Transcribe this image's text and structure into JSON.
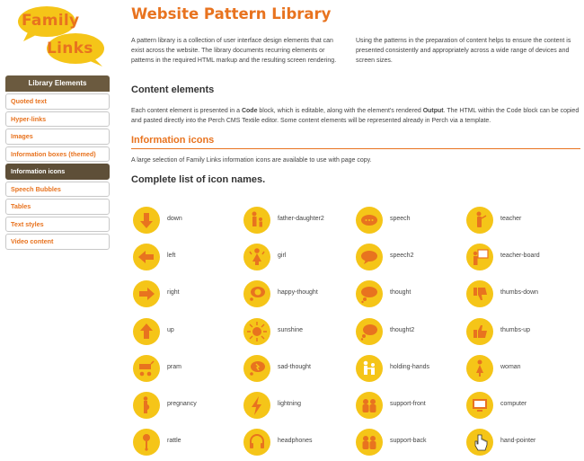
{
  "logo": {
    "word1": "Family",
    "word2": "Links"
  },
  "colors": {
    "accent": "#e8731f",
    "icon_bg": "#f5c518",
    "sidebar_header": "#6b5a3f"
  },
  "sidebar": {
    "header": "Library Elements",
    "items": [
      {
        "label": "Quoted text",
        "active": false
      },
      {
        "label": "Hyper-links",
        "active": false
      },
      {
        "label": "Images",
        "active": false
      },
      {
        "label": "Information boxes (themed)",
        "active": false
      },
      {
        "label": "Information icons",
        "active": true
      },
      {
        "label": "Speech Bubbles",
        "active": false
      },
      {
        "label": "Tables",
        "active": false
      },
      {
        "label": "Text styles",
        "active": false
      },
      {
        "label": "Video content",
        "active": false
      }
    ]
  },
  "main": {
    "title": "Website Pattern Library",
    "intro_left": "A pattern library is a collection of user interface design elements that can exist across the website. The library documents recurring elements or patterns in the required HTML markup and the resulting screen rendering.",
    "intro_right": "Using the patterns in the preparation of content helps to ensure the content is presented consistently and appropriately across a wide range of devices and screen sizes.",
    "content_heading": "Content elements",
    "content_desc_1": "Each content element is presented in a ",
    "content_desc_code": "Code",
    "content_desc_2": " block, which is editable, along with the element's rendered ",
    "content_desc_output": "Output",
    "content_desc_3": ". The HTML within the Code block can be copied and pasted directly into the Perch CMS Textile editor. Some content elements will be represented already in Perch via a template.",
    "info_heading": "Information icons",
    "info_desc": "A large selection of Family Links information icons are available to use with page copy.",
    "list_heading": "Complete list of icon names."
  },
  "icons": [
    {
      "name": "down",
      "icon": "arrow-down-icon"
    },
    {
      "name": "father-daughter2",
      "icon": "father-daughter-icon"
    },
    {
      "name": "speech",
      "icon": "speech-bubble-icon"
    },
    {
      "name": "teacher",
      "icon": "teacher-icon"
    },
    {
      "name": "left",
      "icon": "arrow-left-icon"
    },
    {
      "name": "girl",
      "icon": "girl-icon"
    },
    {
      "name": "speech2",
      "icon": "speech-bubble-2-icon"
    },
    {
      "name": "teacher-board",
      "icon": "teacher-board-icon"
    },
    {
      "name": "right",
      "icon": "arrow-right-icon"
    },
    {
      "name": "happy-thought",
      "icon": "happy-thought-icon"
    },
    {
      "name": "thought",
      "icon": "thought-bubble-icon"
    },
    {
      "name": "thumbs-down",
      "icon": "thumbs-down-icon"
    },
    {
      "name": "up",
      "icon": "arrow-up-icon"
    },
    {
      "name": "sunshine",
      "icon": "sunshine-icon"
    },
    {
      "name": "thought2",
      "icon": "thought-bubble-2-icon"
    },
    {
      "name": "thumbs-up",
      "icon": "thumbs-up-icon"
    },
    {
      "name": "pram",
      "icon": "pram-icon"
    },
    {
      "name": "sad-thought",
      "icon": "sad-thought-icon"
    },
    {
      "name": "holding-hands",
      "icon": "holding-hands-icon"
    },
    {
      "name": "woman",
      "icon": "woman-icon"
    },
    {
      "name": "pregnancy",
      "icon": "pregnancy-icon"
    },
    {
      "name": "lightning",
      "icon": "lightning-icon"
    },
    {
      "name": "support-front",
      "icon": "support-front-icon"
    },
    {
      "name": "computer",
      "icon": "computer-icon"
    },
    {
      "name": "rattle",
      "icon": "rattle-icon"
    },
    {
      "name": "headphones",
      "icon": "headphones-icon"
    },
    {
      "name": "support-back",
      "icon": "support-back-icon"
    },
    {
      "name": "hand-pointer",
      "icon": "hand-pointer-icon"
    }
  ]
}
